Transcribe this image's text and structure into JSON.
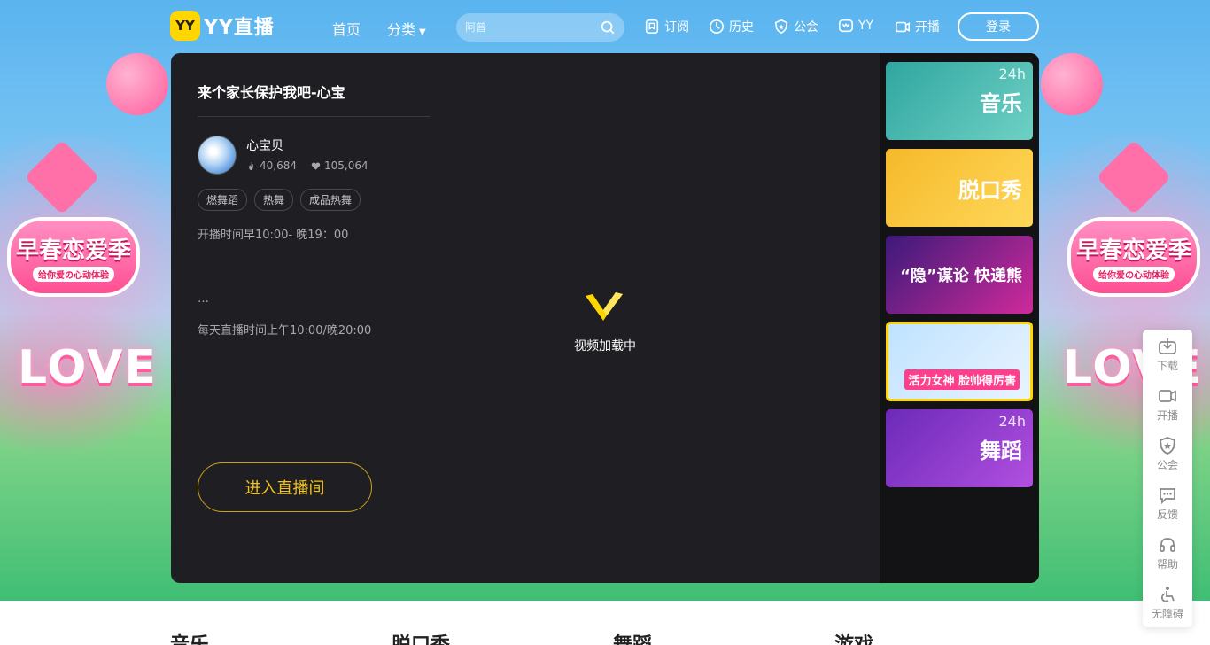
{
  "header": {
    "logo_mark": "YY",
    "logo_text": "YY直播",
    "nav": [
      {
        "label": "首页"
      },
      {
        "label": "分类"
      }
    ],
    "search": {
      "placeholder": "阿普"
    },
    "top_items": [
      {
        "label": "订阅",
        "icon": "bookmark-icon"
      },
      {
        "label": "历史",
        "icon": "clock-icon"
      },
      {
        "label": "公会",
        "icon": "shield-icon"
      },
      {
        "label": "YY",
        "icon": "yy-icon"
      },
      {
        "label": "开播",
        "icon": "camera-icon"
      }
    ],
    "login_label": "登录"
  },
  "room": {
    "title": "来个家长保护我吧-心宝",
    "streamer_name": "心宝贝",
    "hot_count": "40,684",
    "like_count": "105,064",
    "tags": [
      "燃舞蹈",
      "热舞",
      "成品热舞"
    ],
    "schedule": "开播时间早10:00- 晚19：00",
    "ellipsis": "…",
    "daily_schedule": "每天直播时间上午10:00/晚20:00",
    "enter_label": "进入直播间"
  },
  "video": {
    "loading_text": "视频加载中"
  },
  "side_list": [
    {
      "label": "音乐",
      "hours": "24h",
      "color_from": "#2fa6a0",
      "color_to": "#6fd0c4"
    },
    {
      "label": "脱口秀",
      "hours": "",
      "color_from": "#f5b92a",
      "color_to": "#ffd85a"
    },
    {
      "label": "“隐”谋论 快递熊",
      "hours": "",
      "color_from": "#3b1a7a",
      "color_to": "#d02a9a"
    },
    {
      "label": "活力女神 脸帅得厉害",
      "hours": "",
      "color_from": "#bfe3ff",
      "color_to": "#e9f3ff",
      "active": true
    },
    {
      "label": "舞蹈",
      "hours": "24h",
      "color_from": "#6b2ab8",
      "color_to": "#b24fe0"
    }
  ],
  "float_bar": [
    {
      "label": "下载",
      "icon": "download-icon"
    },
    {
      "label": "开播",
      "icon": "camera-icon"
    },
    {
      "label": "公会",
      "icon": "shield-icon"
    },
    {
      "label": "反馈",
      "icon": "chat-icon"
    },
    {
      "label": "帮助",
      "icon": "headset-icon"
    },
    {
      "label": "无障碍",
      "icon": "accessibility-icon"
    }
  ],
  "categories": [
    {
      "label": "音乐"
    },
    {
      "label": "脱口秀"
    },
    {
      "label": "舞蹈"
    },
    {
      "label": "游戏"
    }
  ],
  "promo": {
    "badge_title": "早春恋爱季",
    "badge_sub": "给你爱の心动体验",
    "love_word": "LOVE"
  },
  "colors": {
    "accent": "#ffd600",
    "enter_text": "#f3c21c",
    "panel_bg": "#1f1e22"
  }
}
